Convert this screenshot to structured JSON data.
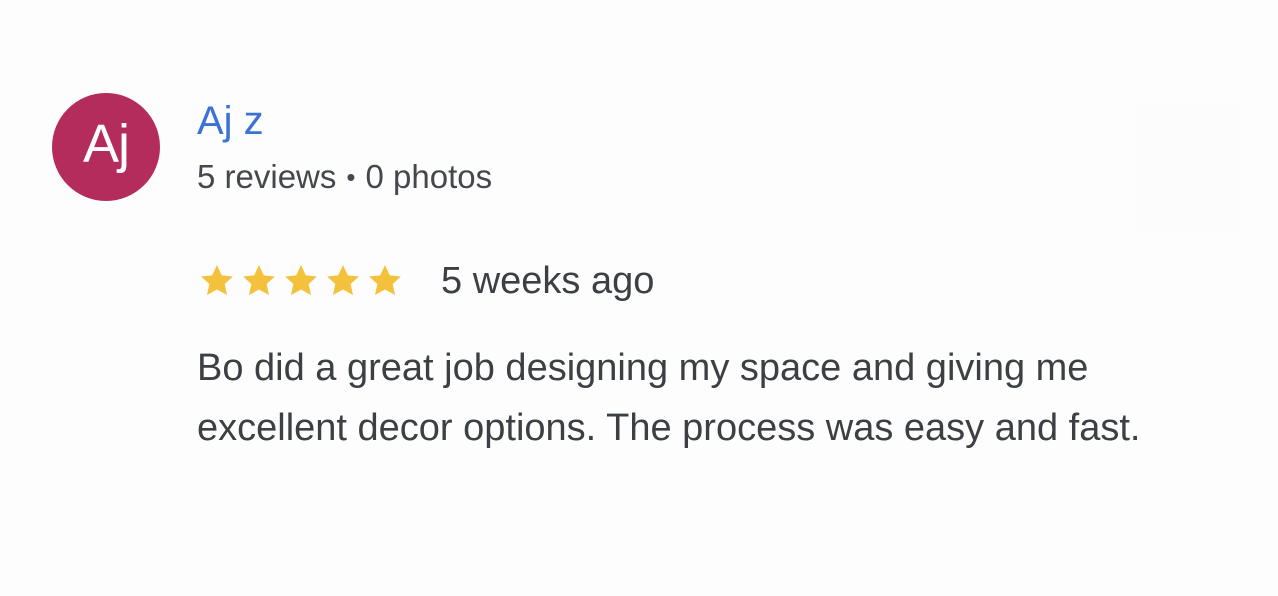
{
  "review": {
    "avatar_initials": "Aj",
    "avatar_color": "#b32c5c",
    "reviewer_name": "Aj z",
    "reviews_count": "5 reviews",
    "separator": "•",
    "photos_count": "0 photos",
    "rating": 5,
    "rating_max": 5,
    "star_color": "#f4c13d",
    "time_ago": "5 weeks ago",
    "text": "Bo did a great job designing my space and giving me excellent decor options. The process was easy and fast."
  },
  "colors": {
    "name_link": "#3a72d8",
    "text": "#3c3f43",
    "background": "#fdfdfd"
  }
}
